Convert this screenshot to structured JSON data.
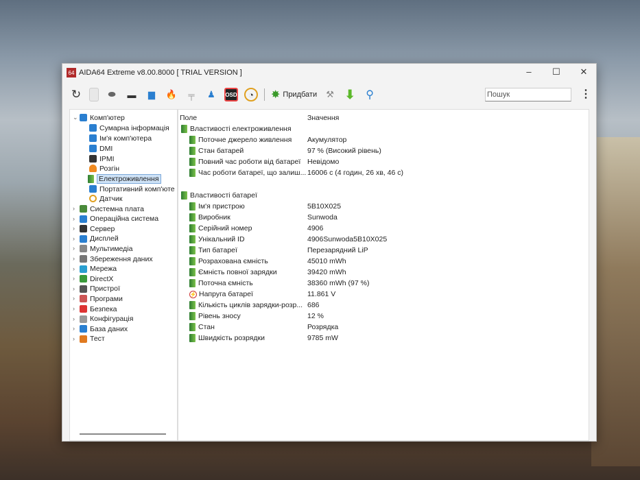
{
  "window": {
    "title": "AIDA64 Extreme v8.00.8000  [ TRIAL VERSION ]",
    "logo": "64",
    "minimize": "–",
    "maximize": "☐",
    "close": "✕"
  },
  "toolbar": {
    "add_label": "Придбати",
    "search_placeholder": "Пошук"
  },
  "tree": {
    "root": "Комп'ютер",
    "children": [
      "Сумарна інформація",
      "Ім'я комп'ютера",
      "DMI",
      "IPMI",
      "Розгін",
      "Електроживлення",
      "Портативний комп'юте",
      "Датчик"
    ],
    "selected": "Електроживлення",
    "top": [
      "Системна плата",
      "Операційна система",
      "Сервер",
      "Дисплей",
      "Мультимедіа",
      "Збереження даних",
      "Мережа",
      "DirectX",
      "Пристрої",
      "Програми",
      "Безпека",
      "Конфігурація",
      "База даних",
      "Тест"
    ]
  },
  "table": {
    "headers": [
      "Поле",
      "Значення"
    ],
    "groups": [
      {
        "title": "Властивості електроживлення",
        "rows": [
          {
            "field": "Поточне джерело живлення",
            "value": "Акумулятор"
          },
          {
            "field": "Стан батарей",
            "value": "97 % (Високий рівень)"
          },
          {
            "field": "Повний час роботи від батареї",
            "value": "Невідомо"
          },
          {
            "field": "Час роботи батареї, що залиш...",
            "value": "16006 с (4 годин, 26 хв, 46 с)"
          }
        ]
      },
      {
        "title": "Властивості батареї",
        "rows": [
          {
            "field": "Ім'я пристрою",
            "value": "5B10X025"
          },
          {
            "field": "Виробник",
            "value": "Sunwoda"
          },
          {
            "field": "Серійний номер",
            "value": "4906"
          },
          {
            "field": "Унікальний ID",
            "value": "4906Sunwoda5B10X025"
          },
          {
            "field": "Тип батареї",
            "value": "Перезарядний LiP"
          },
          {
            "field": "Розрахована ємність",
            "value": "45010 mWh"
          },
          {
            "field": "Ємність повної зарядки",
            "value": "39420 mWh"
          },
          {
            "field": "Поточна ємність",
            "value": "38360 mWh  (97 %)"
          },
          {
            "field": "Напруга батареї",
            "value": "11.861 V",
            "icon": "voltage"
          },
          {
            "field": "Кількість циклів зарядки-розр...",
            "value": "686"
          },
          {
            "field": "Рівень зносу",
            "value": "12 %"
          },
          {
            "field": "Стан",
            "value": "Розрядка"
          },
          {
            "field": "Швидкість розрядки",
            "value": "9785 mW"
          }
        ]
      }
    ]
  }
}
